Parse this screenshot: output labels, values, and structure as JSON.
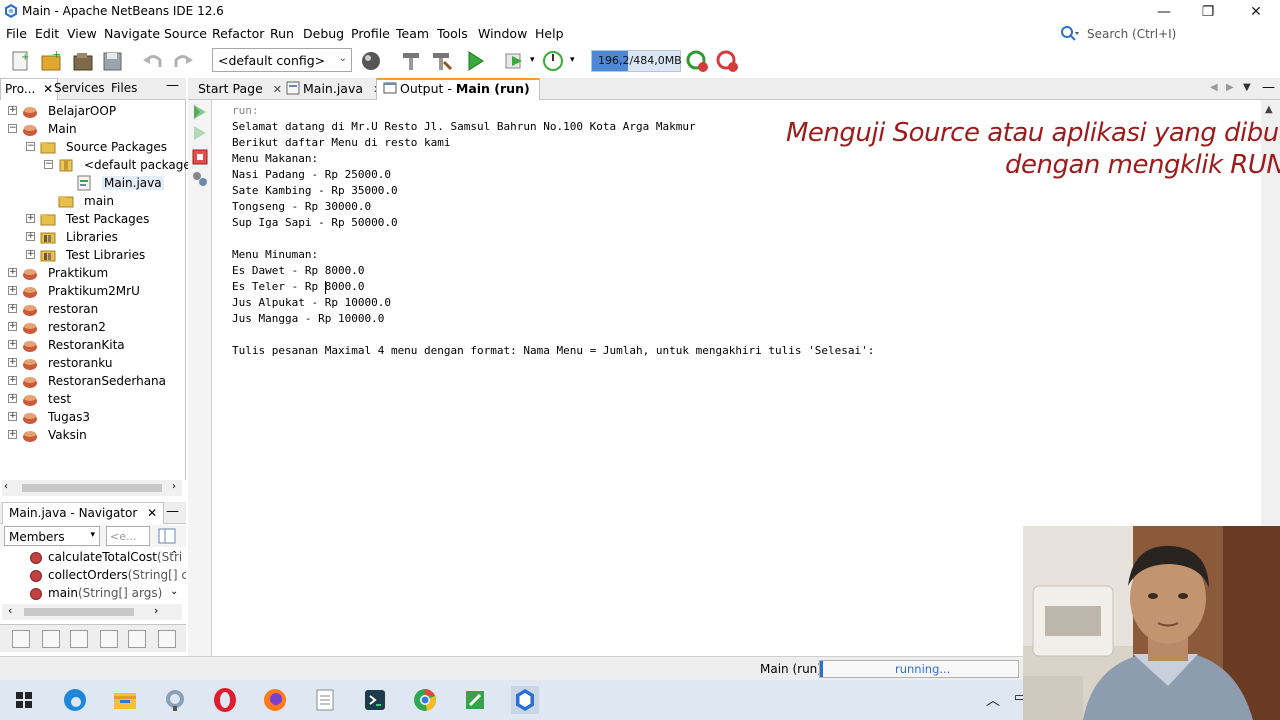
{
  "window": {
    "title": "Main - Apache NetBeans IDE 12.6",
    "controls": [
      "—",
      "❐",
      "✕"
    ]
  },
  "menu": [
    "File",
    "Edit",
    "View",
    "Navigate",
    "Source",
    "Refactor",
    "Run",
    "Debug",
    "Profile",
    "Team",
    "Tools",
    "Window",
    "Help"
  ],
  "search": {
    "placeholder": "Search (Ctrl+I)"
  },
  "toolbar": {
    "config": "<default config>",
    "memory_text": "196,2/484,0MB",
    "memory_used_fraction": 0.405
  },
  "left_tabs": [
    "Pro...",
    "Services",
    "Files"
  ],
  "project_tree": [
    {
      "label": "BelajarOOP",
      "level": 0,
      "expander": "+",
      "icon": "project-icon"
    },
    {
      "label": "Main",
      "level": 0,
      "expander": "−",
      "icon": "project-icon"
    },
    {
      "label": "Source Packages",
      "level": 1,
      "expander": "−",
      "icon": "folder-icon"
    },
    {
      "label": "<default package>",
      "level": 2,
      "expander": "−",
      "icon": "package-icon"
    },
    {
      "label": "Main.java",
      "level": 3,
      "expander": "",
      "icon": "java-file-icon",
      "selected": true
    },
    {
      "label": "main",
      "level": 2,
      "expander": "",
      "icon": "folder-icon"
    },
    {
      "label": "Test Packages",
      "level": 1,
      "expander": "+",
      "icon": "folder-icon"
    },
    {
      "label": "Libraries",
      "level": 1,
      "expander": "+",
      "icon": "library-icon"
    },
    {
      "label": "Test Libraries",
      "level": 1,
      "expander": "+",
      "icon": "library-icon"
    },
    {
      "label": "Praktikum",
      "level": 0,
      "expander": "+",
      "icon": "project-icon"
    },
    {
      "label": "Praktikum2MrU",
      "level": 0,
      "expander": "+",
      "icon": "project-icon"
    },
    {
      "label": "restoran",
      "level": 0,
      "expander": "+",
      "icon": "project-icon"
    },
    {
      "label": "restoran2",
      "level": 0,
      "expander": "+",
      "icon": "project-icon"
    },
    {
      "label": "RestoranKita",
      "level": 0,
      "expander": "+",
      "icon": "project-icon"
    },
    {
      "label": "restoranku",
      "level": 0,
      "expander": "+",
      "icon": "project-icon"
    },
    {
      "label": "RestoranSederhana",
      "level": 0,
      "expander": "+",
      "icon": "project-icon"
    },
    {
      "label": "test",
      "level": 0,
      "expander": "+",
      "icon": "project-icon"
    },
    {
      "label": "Tugas3",
      "level": 0,
      "expander": "+",
      "icon": "project-icon"
    },
    {
      "label": "Vaksin",
      "level": 0,
      "expander": "+",
      "icon": "project-icon"
    }
  ],
  "navigator": {
    "tab": "Main.java - Navigator",
    "members_select": "Members",
    "filter_placeholder": "<e...",
    "items": [
      {
        "name": "calculateTotalCost",
        "sig": "(Stri"
      },
      {
        "name": "collectOrders",
        "sig": "(String[] c"
      },
      {
        "name": "main",
        "sig": "(String[] args)"
      }
    ]
  },
  "editor_tabs": [
    {
      "label": "Start Page",
      "active": false
    },
    {
      "label": "Main.java",
      "active": false
    },
    {
      "label": "Output - ",
      "bold": "Main (run)",
      "active": true
    }
  ],
  "output_lines": [
    "run:",
    "Selamat datang di Mr.U Resto Jl. Samsul Bahrun No.100 Kota Arga Makmur",
    "Berikut daftar Menu di resto kami",
    "Menu Makanan:",
    "Nasi Padang - Rp 25000.0",
    "Sate Kambing - Rp 35000.0",
    "Tongseng - Rp 30000.0",
    "Sup Iga Sapi - Rp 50000.0",
    "",
    "Menu Minuman:",
    "Es Dawet - Rp 8000.0",
    "Es Teler - Rp 8000.0",
    "Jus Alpukat - Rp 10000.0",
    "Jus Mangga - Rp 10000.0",
    "",
    "Tulis pesanan Maximal 4 menu dengan format: Nama Menu = Jumlah, untuk mengakhiri tulis 'Selesai':"
  ],
  "annotation": {
    "line1": "Menguji Source atau aplikasi yang dibuat",
    "line2": "dengan mengklik RUN"
  },
  "status": {
    "task": "Main (run)",
    "progress_text": "running..."
  },
  "colors": {
    "annotation": "#9e1b1b",
    "accent": "#2a6fd6",
    "active_tab_marker": "#f0a030"
  }
}
